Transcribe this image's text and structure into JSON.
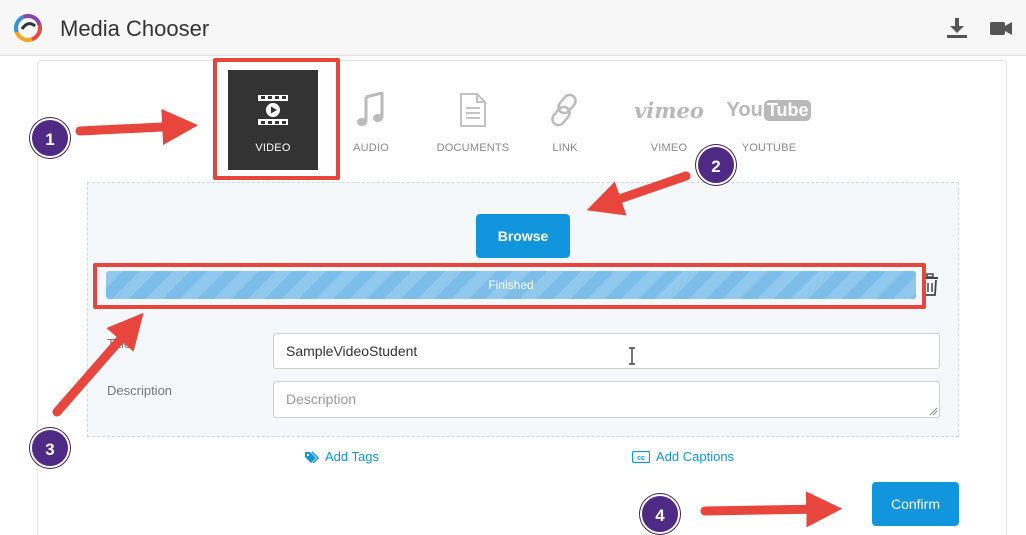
{
  "header": {
    "title": "Media Chooser",
    "icons": [
      "download-icon",
      "video-camera-icon"
    ]
  },
  "media_types": [
    {
      "label": "VIDEO",
      "icon": "video-icon",
      "active": true
    },
    {
      "label": "AUDIO",
      "icon": "music-note-icon",
      "active": false
    },
    {
      "label": "DOCUMENTS",
      "icon": "document-icon",
      "active": false
    },
    {
      "label": "LINK",
      "icon": "link-icon",
      "active": false
    },
    {
      "label": "VIMEO",
      "icon": "vimeo-logo",
      "logo_text": "vimeo",
      "active": false
    },
    {
      "label": "YOUTUBE",
      "icon": "youtube-logo",
      "logo_text_you": "You",
      "logo_text_tube": "Tube",
      "active": false
    }
  ],
  "upload": {
    "browse_label": "Browse",
    "progress_status": "Finished",
    "progress_fraction": 1.0
  },
  "form": {
    "title_label": "Title",
    "title_value": "SampleVideoStudent",
    "description_label": "Description",
    "description_placeholder": "Description"
  },
  "links": {
    "add_tags": "Add Tags",
    "add_captions": "Add Captions",
    "captions_icon_text": "cc"
  },
  "confirm_label": "Confirm",
  "annotations": {
    "steps": [
      "1",
      "2",
      "3",
      "4"
    ],
    "color": "#e8453c",
    "step_color": "#4e2a84"
  },
  "colors": {
    "accent": "#1196dd",
    "active_tab_bg": "#333333"
  }
}
